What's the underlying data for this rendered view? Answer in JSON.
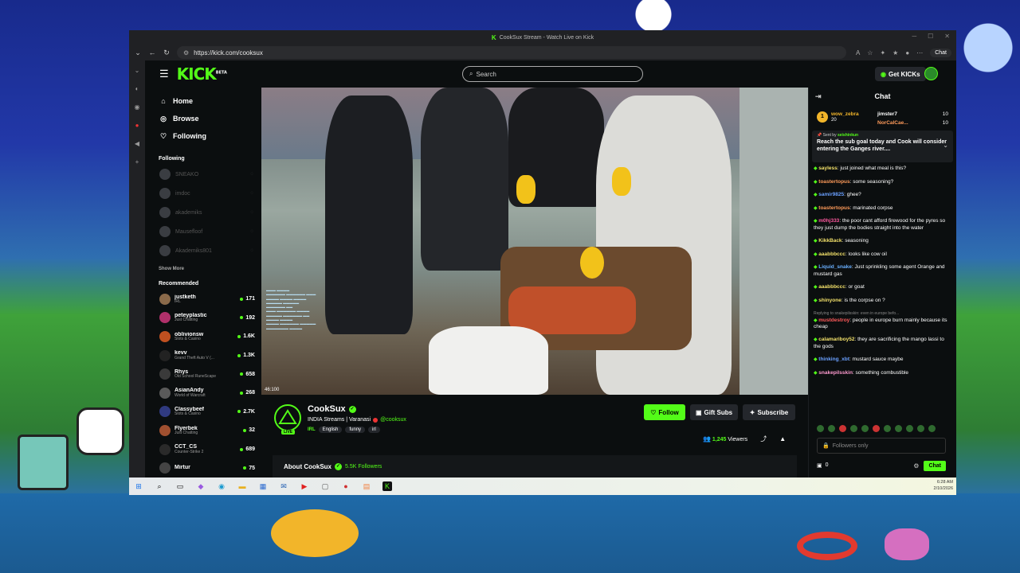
{
  "browser": {
    "tab_title": "CookSux Stream - Watch Live on Kick",
    "url": "https://kick.com/cooksux",
    "chat_pill": "Chat"
  },
  "nav": {
    "logo": "KICK",
    "logo_sup": "BETA",
    "search_placeholder": "Search",
    "get_kicks": "Get KICKs"
  },
  "sidebar": {
    "main": [
      {
        "label": "Home",
        "icon": "home-icon"
      },
      {
        "label": "Browse",
        "icon": "compass-icon"
      },
      {
        "label": "Following",
        "icon": "heart-icon"
      }
    ],
    "following_title": "Following",
    "following": [
      {
        "name": "SNEAKO"
      },
      {
        "name": "imdoc"
      },
      {
        "name": "akademiks"
      },
      {
        "name": "Mausefloof"
      },
      {
        "name": "Akademiks801"
      }
    ],
    "show_more": "Show More",
    "recommended_title": "Recommended",
    "recommended": [
      {
        "name": "justketh",
        "category": "IRL",
        "viewers": "171",
        "color": "#8a6a4a"
      },
      {
        "name": "peteyplastic",
        "category": "Just Chatting",
        "viewers": "192",
        "color": "#b0306a"
      },
      {
        "name": "oblivionsw",
        "category": "Slots & Casino",
        "viewers": "1.6K",
        "color": "#c05020"
      },
      {
        "name": "kevv",
        "category": "Grand Theft Auto V (...",
        "viewers": "1.3K",
        "color": "#222222"
      },
      {
        "name": "Rhys",
        "category": "Old School RuneScape",
        "viewers": "658",
        "color": "#3a3a3a"
      },
      {
        "name": "AsianAndy",
        "category": "World of Warcraft",
        "viewers": "268",
        "color": "#5a5a5a"
      },
      {
        "name": "Classybeef",
        "category": "Slots & Casino",
        "viewers": "2.7K",
        "color": "#303a80"
      },
      {
        "name": "Flyerbek",
        "category": "Just Chatting",
        "viewers": "32",
        "color": "#a05030"
      },
      {
        "name": "CCT_CS",
        "category": "Counter-Strike 2",
        "viewers": "689",
        "color": "#2a2a2a"
      },
      {
        "name": "Mirtur",
        "category": "",
        "viewers": "75",
        "color": "#444444"
      }
    ]
  },
  "player": {
    "timer": "46:100"
  },
  "channel": {
    "name": "CookSux",
    "live": "LIVE",
    "title_prefix": "INDIA Streams | Varanasi",
    "handle": "@cooksux",
    "category": "IRL",
    "tags": [
      "English",
      "funny",
      "irl"
    ],
    "follow": "Follow",
    "gift_subs": "Gift Subs",
    "subscribe": "Subscribe",
    "viewer_count": "1,245",
    "viewers_label": "Viewers",
    "about_title": "About CookSux",
    "followers": "5.5K Followers"
  },
  "chat": {
    "title": "Chat",
    "leaderboard": {
      "top": {
        "rank": "1",
        "name": "wow_zebra",
        "value": "20"
      },
      "others": [
        {
          "name": "jimster7",
          "value": "10"
        },
        {
          "name": "NorCalCae...",
          "value": "10"
        }
      ]
    },
    "pinned": {
      "sent_by_label": "Sent by",
      "sent_by": "seishinkun",
      "message": "Reach the sub goal today and Cook will consider entering the Ganges river...."
    },
    "messages": [
      {
        "user": "sayless",
        "color": "#f2e06a",
        "text": "just joined what meal is this?",
        "reply": ""
      },
      {
        "user": "toastertopus",
        "color": "#ff9b5a",
        "text": "some seasoning?",
        "reply": ""
      },
      {
        "user": "samir9825",
        "color": "#6aa0ff",
        "text": "ghee?",
        "reply": ""
      },
      {
        "user": "toastertopus",
        "color": "#ff9b5a",
        "text": "marinated corpse",
        "reply": ""
      },
      {
        "user": "m0hj333",
        "color": "#ff5aa0",
        "text": "the poor cant afford firewood for the pyres so they just dump the bodies straight into the water",
        "reply": ""
      },
      {
        "user": "KikkBack",
        "color": "#f2e06a",
        "text": "seasoning",
        "reply": ""
      },
      {
        "user": "aaabbbccc",
        "color": "#f2e06a",
        "text": "looks like cow oil",
        "reply": ""
      },
      {
        "user": "Liquid_snake",
        "color": "#6ab0ff",
        "text": "Just sprinkling some agent Orange and mustard gas",
        "reply": ""
      },
      {
        "user": "aaabbbccc",
        "color": "#f2e06a",
        "text": "or goat",
        "reply": ""
      },
      {
        "user": "shinyone",
        "color": "#f2e06a",
        "text": "is the corpse on ?",
        "reply": ""
      },
      {
        "user": "mustdestroy",
        "color": "#ff5a5a",
        "text": "people in europe burn mainly because its cheap",
        "reply": "Replying to snakepilsskin: even in europe befo..."
      },
      {
        "user": "calamariboy52",
        "color": "#f2e06a",
        "text": "they are sacrificing the mango lassi to the gods",
        "reply": ""
      },
      {
        "user": "thinking_xbt",
        "color": "#6aa0ff",
        "text": "mustard sauce maybe",
        "reply": ""
      },
      {
        "user": "snakepilsskin",
        "color": "#ff9bd0",
        "text": "something combustible",
        "reply": ""
      }
    ],
    "input_placeholder": "Followers only",
    "kicks_count": "0",
    "send": "Chat"
  },
  "taskbar": {
    "time": "6:28 AM",
    "date": "2/10/2026"
  }
}
